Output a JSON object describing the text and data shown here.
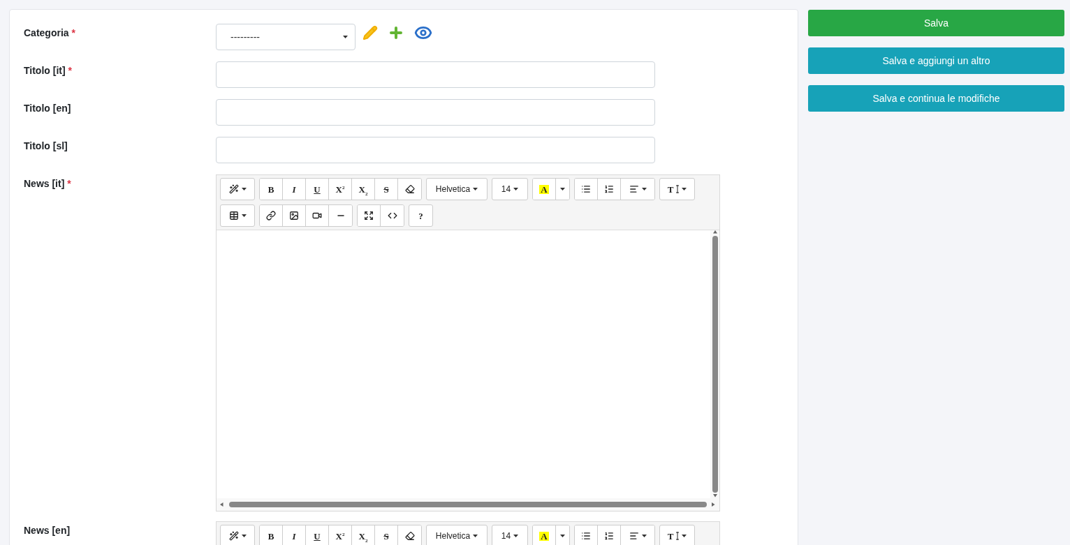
{
  "form": {
    "fields": [
      {
        "kind": "select",
        "label": "Categoria",
        "required_mark": "*",
        "value": "---------"
      },
      {
        "kind": "text",
        "label": "Titolo [it]",
        "required_mark": "*"
      },
      {
        "kind": "text",
        "label": "Titolo [en]"
      },
      {
        "kind": "text",
        "label": "Titolo [sl]"
      },
      {
        "kind": "editor",
        "label": "News [it]",
        "required_mark": "*",
        "toolbar": {
          "bold": "B",
          "italic": "I",
          "underline": "U",
          "superscript": "X$^{2}$",
          "subscript": "X$_{2}$",
          "strike": "S",
          "font": "Helvetica",
          "size": "14",
          "highlight": "A",
          "height": "T",
          "help": "?"
        }
      },
      {
        "kind": "editor",
        "label": "News [en]",
        "toolbar": {
          "bold": "B",
          "italic": "I",
          "underline": "U",
          "superscript": "X$^{2}$",
          "subscript": "X$_{2}$",
          "strike": "S",
          "font": "Helvetica",
          "size": "14",
          "highlight": "A",
          "height": "T"
        }
      }
    ]
  },
  "actions": [
    {
      "kind": "primary",
      "label": "Salva"
    },
    {
      "kind": "secondary",
      "label": "Salva e aggiungi un altro"
    },
    {
      "kind": "secondary",
      "label": "Salva e continua le modifiche"
    }
  ]
}
